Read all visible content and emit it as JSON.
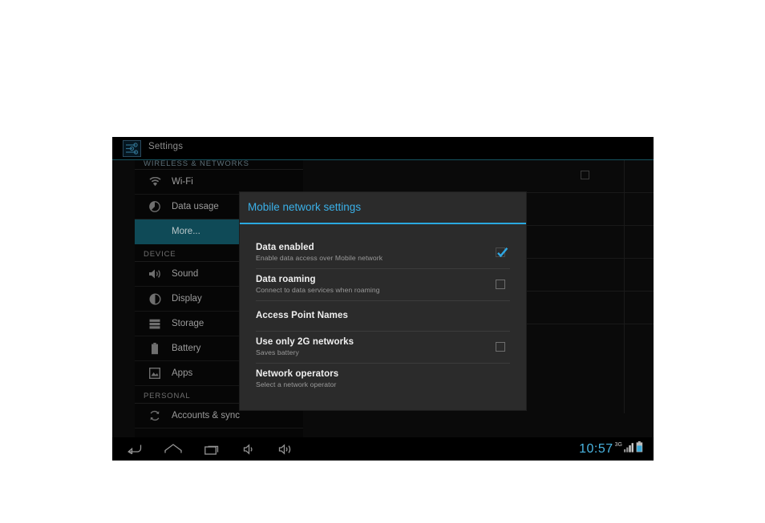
{
  "app": {
    "title": "Settings",
    "icon": "settings-sliders-icon"
  },
  "colors": {
    "accent": "#2aa8e0",
    "dialog_title": "#3ab0e8",
    "selected_item_bg": "#0f4a57",
    "clock": "#49b4e0",
    "dialog_bg": "#2b2b2b"
  },
  "sidebar": {
    "sections": [
      {
        "header": "WIRELESS & NETWORKS",
        "items": [
          {
            "label": "Wi-Fi",
            "icon": "wifi-icon",
            "selected": false
          },
          {
            "label": "Data usage",
            "icon": "data-usage-icon",
            "selected": false
          },
          {
            "label": "More...",
            "icon": "",
            "selected": true
          }
        ]
      },
      {
        "header": "DEVICE",
        "items": [
          {
            "label": "Sound",
            "icon": "sound-icon",
            "selected": false
          },
          {
            "label": "Display",
            "icon": "display-icon",
            "selected": false
          },
          {
            "label": "Storage",
            "icon": "storage-icon",
            "selected": false
          },
          {
            "label": "Battery",
            "icon": "battery-icon",
            "selected": false
          },
          {
            "label": "Apps",
            "icon": "apps-icon",
            "selected": false
          }
        ]
      },
      {
        "header": "PERSONAL",
        "items": [
          {
            "label": "Accounts & sync",
            "icon": "sync-icon",
            "selected": false
          }
        ]
      }
    ]
  },
  "dialog": {
    "title": "Mobile network settings",
    "rows": [
      {
        "title": "Data enabled",
        "subtitle": "Enable data access over Mobile network",
        "control": "checkbox",
        "checked": true
      },
      {
        "title": "Data roaming",
        "subtitle": "Connect to data services when roaming",
        "control": "checkbox",
        "checked": false
      },
      {
        "title": "Access Point Names",
        "subtitle": "",
        "control": "none",
        "checked": false
      },
      {
        "title": "Use only 2G networks",
        "subtitle": "Saves battery",
        "control": "checkbox",
        "checked": false
      },
      {
        "title": "Network operators",
        "subtitle": "Select a network operator",
        "control": "none",
        "checked": false
      }
    ]
  },
  "navbar": {
    "buttons": [
      {
        "name": "back-icon",
        "label": "Back"
      },
      {
        "name": "home-icon",
        "label": "Home"
      },
      {
        "name": "recents-icon",
        "label": "Recent apps"
      },
      {
        "name": "volume-down-icon",
        "label": "Volume down"
      },
      {
        "name": "volume-up-icon",
        "label": "Volume up"
      }
    ],
    "status": {
      "clock": "10:57",
      "signal_label": "3G",
      "signal_icon": "signal-bars-icon",
      "battery_icon": "battery-status-icon"
    }
  }
}
